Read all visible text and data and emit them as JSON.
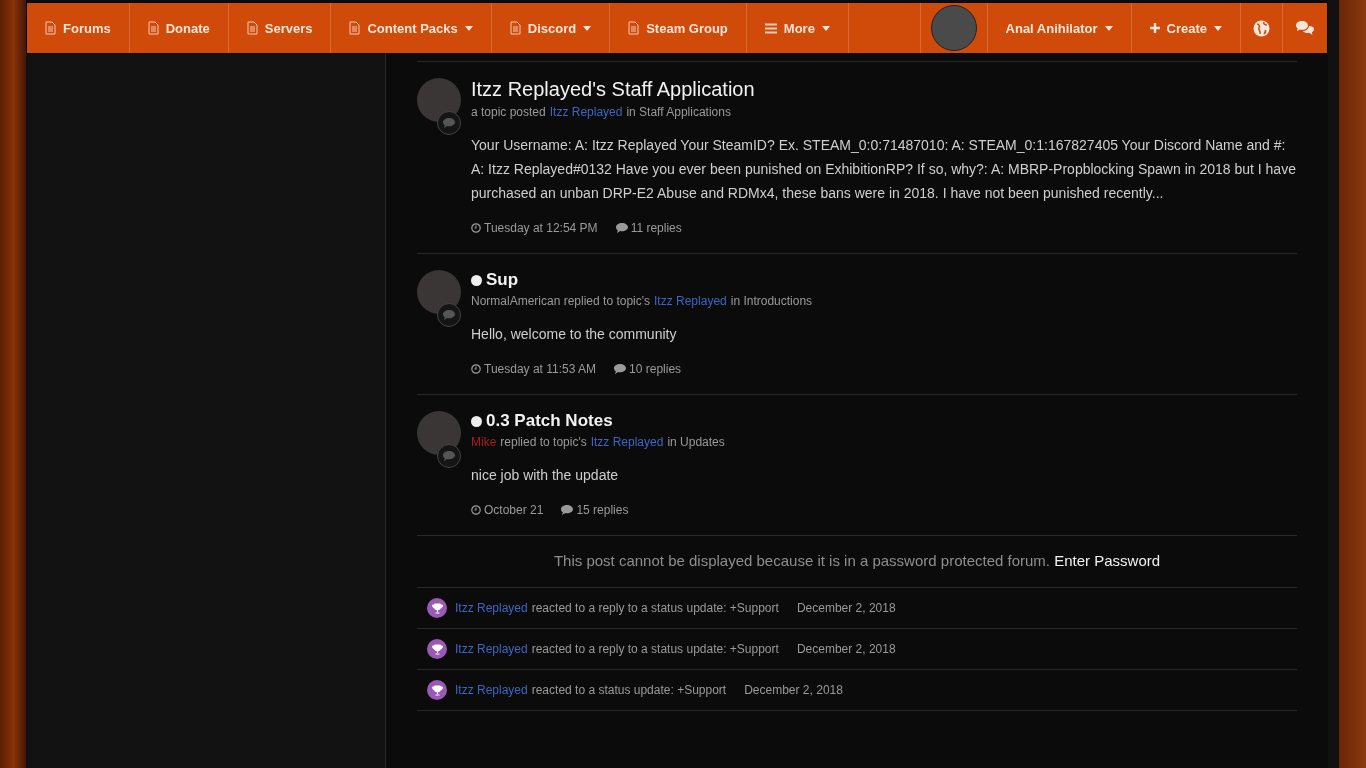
{
  "nav": {
    "items": [
      {
        "label": "Forums",
        "kind": "page",
        "dropdown": false
      },
      {
        "label": "Donate",
        "kind": "page",
        "dropdown": false
      },
      {
        "label": "Servers",
        "kind": "page",
        "dropdown": false
      },
      {
        "label": "Content Packs",
        "kind": "page",
        "dropdown": true
      },
      {
        "label": "Discord",
        "kind": "page",
        "dropdown": true
      },
      {
        "label": "Steam Group",
        "kind": "page",
        "dropdown": false
      },
      {
        "label": "More",
        "kind": "menu",
        "dropdown": true
      }
    ],
    "user": {
      "name": "Anal Anihilator"
    },
    "create": {
      "label": "Create"
    }
  },
  "activity": [
    {
      "title": "Itzz Replayed's Staff Application",
      "unread": false,
      "meta": [
        {
          "text": "a topic posted",
          "kind": "text"
        },
        {
          "text": "Itzz Replayed",
          "kind": "link"
        },
        {
          "text": "in Staff Applications",
          "kind": "text"
        }
      ],
      "body": "Your Username: A: Itzz Replayed Your SteamID? Ex. STEAM_0:0:71487010: A: STEAM_0:1:167827405 Your Discord Name and #: A: Itzz Replayed#0132 Have you ever been punished on ExhibitionRP? If so, why?: A: MBRP-Propblocking Spawn in 2018 but I have purchased an unban DRP-E2 Abuse and RDMx4, these bans were in 2018. I have not been punished recently...",
      "time": "Tuesday at 12:54 PM",
      "replies": "11 replies"
    },
    {
      "title": "Sup",
      "unread": true,
      "meta": [
        {
          "text": "NormalAmerican replied to topic's",
          "kind": "text"
        },
        {
          "text": "Itzz Replayed",
          "kind": "link"
        },
        {
          "text": "in Introductions",
          "kind": "text"
        }
      ],
      "body": "Hello, welcome to the community",
      "time": "Tuesday at 11:53 AM",
      "replies": "10 replies"
    },
    {
      "title": "0.3 Patch Notes",
      "unread": true,
      "meta": [
        {
          "text": "Mike",
          "kind": "staff"
        },
        {
          "text": "replied to topic's",
          "kind": "text"
        },
        {
          "text": "Itzz Replayed",
          "kind": "link"
        },
        {
          "text": "in Updates",
          "kind": "text"
        }
      ],
      "body": "nice job with the update",
      "time": "October 21",
      "replies": "15 replies"
    }
  ],
  "protected": {
    "message": "This post cannot be displayed because it is in a password protected forum.",
    "link": "Enter Password"
  },
  "reactions": [
    {
      "user": "Itzz Replayed",
      "action": "reacted to a reply to a status update: +Support",
      "date": "December 2, 2018"
    },
    {
      "user": "Itzz Replayed",
      "action": "reacted to a reply to a status update: +Support",
      "date": "December 2, 2018"
    },
    {
      "user": "Itzz Replayed",
      "action": "reacted to a status update: +Support",
      "date": "December 2, 2018"
    }
  ]
}
